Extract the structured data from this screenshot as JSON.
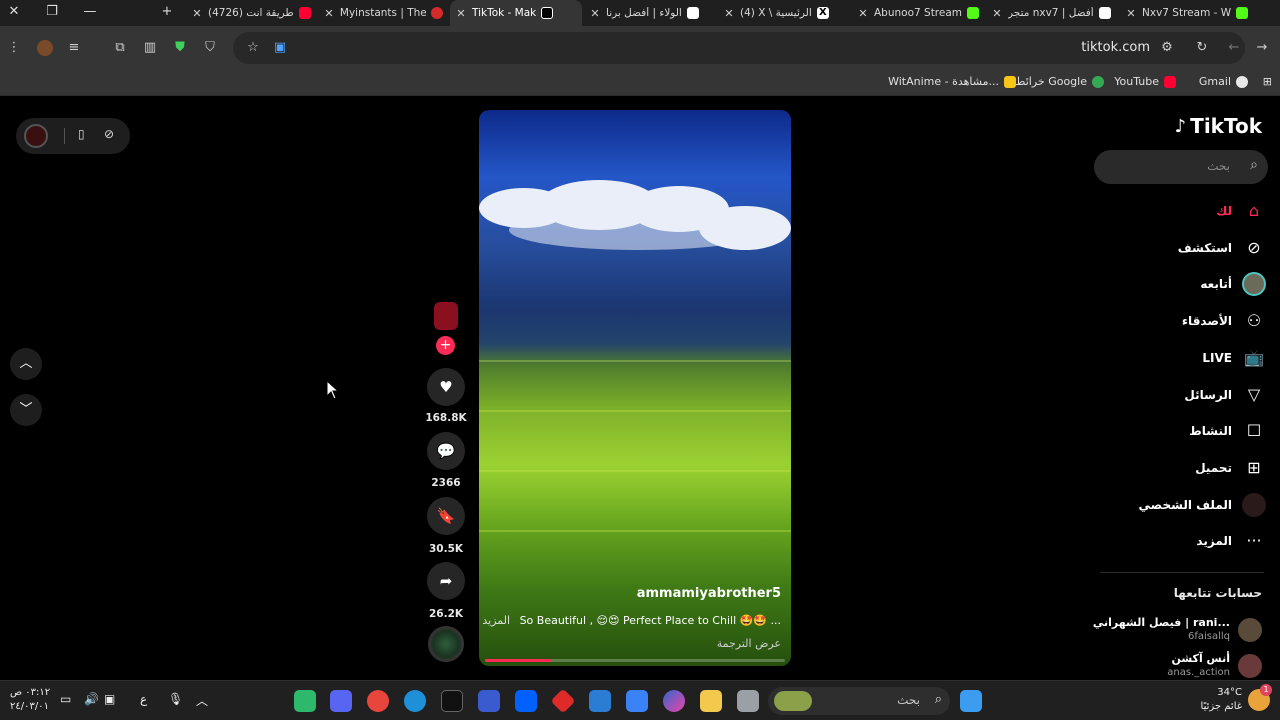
{
  "browser": {
    "tabs": [
      {
        "title": "Nxv7 Stream - W",
        "color": "#53fc18",
        "active": false
      },
      {
        "title": "متجر nxv7 | أفضل",
        "color": "#ffffff",
        "active": false
      },
      {
        "title": "Abunoo7 Stream",
        "color": "#53fc18",
        "active": false
      },
      {
        "title": "(4) X \\ الرئيسية",
        "color": "#ffffff",
        "active": false
      },
      {
        "title": "الولاء | أفضل برنا",
        "color": "#ffffff",
        "active": false
      },
      {
        "title": "TikTok - Mak",
        "color": "#000000",
        "active": true
      },
      {
        "title": "Myinstants | The",
        "color": "#d42a2a",
        "active": false
      },
      {
        "title": "(4726) طريقة انت",
        "color": "#ff0033",
        "active": false
      }
    ],
    "url": "tiktok.com",
    "bookmarks": [
      {
        "label": "Gmail",
        "color": "#e8e8e8"
      },
      {
        "label": "YouTube",
        "color": "#ff0033"
      },
      {
        "label": "خرائط Google",
        "color": "#34a853"
      },
      {
        "label": "WitAnime - مشاهدة...",
        "color": "#f5c518"
      }
    ]
  },
  "tiktok": {
    "logo": "TikTok",
    "search_placeholder": "بحث",
    "nav": [
      {
        "label": "لك",
        "icon": "home-icon",
        "active": true
      },
      {
        "label": "استكشف",
        "icon": "compass-icon",
        "active": false
      },
      {
        "label": "أتابعه",
        "icon": "avatar",
        "active": false
      },
      {
        "label": "الأصدقاء",
        "icon": "friends-icon",
        "active": false
      },
      {
        "label": "LIVE",
        "icon": "live-icon",
        "active": false
      },
      {
        "label": "الرسائل",
        "icon": "messages-icon",
        "active": false
      },
      {
        "label": "النشاط",
        "icon": "activity-icon",
        "active": false
      },
      {
        "label": "تحميل",
        "icon": "upload-icon",
        "active": false
      },
      {
        "label": "الملف الشخصي",
        "icon": "profile-avatar",
        "active": false
      },
      {
        "label": "المزيد",
        "icon": "more-icon",
        "active": false
      }
    ],
    "following_title": "حسابات تتابعها",
    "following": [
      {
        "name": "فيصل الشهراني | rani...",
        "username": "6faisallq",
        "color": "#5a4a3a"
      },
      {
        "name": "أنس آكشن",
        "username": "anas._action",
        "color": "#6a3a3a"
      }
    ],
    "video": {
      "username": "ammamiyabrother5",
      "caption": "So Beautiful , 😌😍 Perfect Place to Chill 🤩🤩 ...",
      "more": "المزيد",
      "translate": "عرض الترجمة",
      "progress": 0.22
    },
    "actions": {
      "likes": "168.8K",
      "comments": "2366",
      "saves": "30.5K",
      "shares": "26.2K"
    }
  },
  "taskbar": {
    "search_placeholder": "بحث",
    "clock_time": "٠٣:١٢ ص",
    "clock_date": "٢٤/٠٣/٠١",
    "lang": "ع",
    "weather_temp": "34°C",
    "weather_text": "غائم جزئيًا",
    "notification_count": "1"
  }
}
